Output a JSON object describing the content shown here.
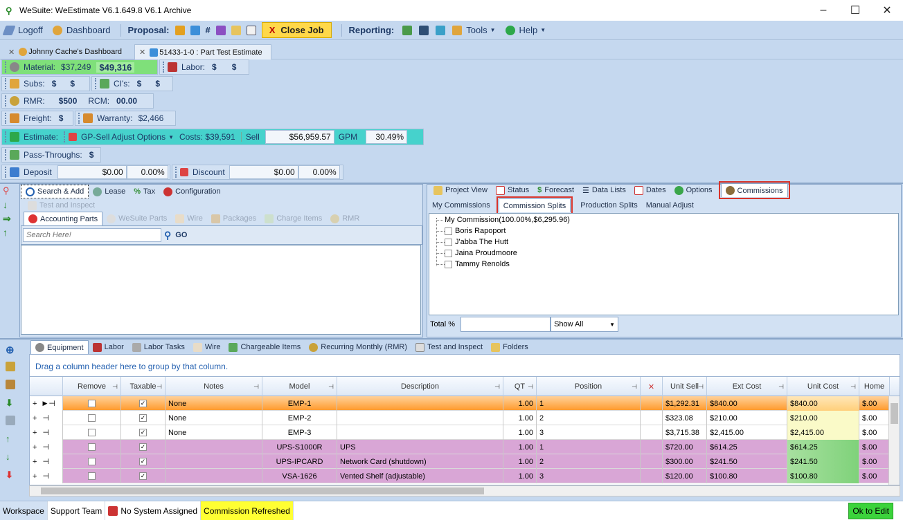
{
  "window": {
    "title": "WeSuite: WeEstimate V6.1.649.8 V6.1 Archive"
  },
  "toolbar": {
    "logoff": "Logoff",
    "dashboard": "Dashboard",
    "proposal": "Proposal:",
    "close_job": "Close Job",
    "reporting": "Reporting:",
    "tools": "Tools",
    "help": "Help"
  },
  "doc_tabs": [
    {
      "label": "Johnny Cache's Dashboard"
    },
    {
      "label": "51433-1-0 : Part Test Estimate"
    }
  ],
  "summary": {
    "material_label": "Material:",
    "material_cost": "$37,249",
    "material_sell": "$49,316",
    "labor_label": "Labor:",
    "labor_cost": "$",
    "labor_sell": "$",
    "subs_label": "Subs:",
    "subs_cost": "$",
    "subs_sell": "$",
    "cis_label": "CI's:",
    "cis_cost": "$",
    "cis_sell": "$",
    "rmr_label": "RMR:",
    "rmr_value": "$500",
    "rcm_label": "RCM:",
    "rcm_value": "00.00",
    "freight_label": "Freight:",
    "freight_value": "$",
    "warranty_label": "Warranty:",
    "warranty_value": "$2,466",
    "estimate_label": "Estimate:",
    "gp_sell_label": "GP-Sell Adjust Options",
    "costs_text": "Costs: $39,591",
    "sell_label": "Sell",
    "sell_value": "$56,959.57",
    "gpm_label": "GPM",
    "gpm_value": "30.49%",
    "pass_label": "Pass-Throughs:",
    "pass_value": "$",
    "deposit_label": "Deposit",
    "deposit_amount": "$0.00",
    "deposit_pct": "0.00%",
    "discount_label": "Discount",
    "discount_amount": "$0.00",
    "discount_pct": "0.00%"
  },
  "left_panel": {
    "tabs_row1": [
      "Search & Add",
      "Lease",
      "Tax",
      "Configuration"
    ],
    "tabs_row2": [
      "Test and Inspect"
    ],
    "tabs_row3": [
      "Accounting Parts",
      "WeSuite Parts",
      "Wire",
      "Packages",
      "Charge Items",
      "RMR"
    ],
    "search_placeholder": "Search Here!",
    "go_label": "GO"
  },
  "right_panel": {
    "tabs": [
      "Project View",
      "Status",
      "Forecast",
      "Data Lists",
      "Dates",
      "Options",
      "Commissions"
    ],
    "subtabs": [
      "My Commissions",
      "Commission Splits",
      "Production Splits",
      "Manual Adjust"
    ],
    "tree_root": "My Commission(100.00%,$6,295.96)",
    "tree_items": [
      "Boris Rapoport",
      "J'abba The Hutt",
      "Jaina Proudmoore",
      "Tammy Renolds"
    ],
    "total_label": "Total %",
    "show_all": "Show All"
  },
  "bottom": {
    "tabs": [
      "Equipment",
      "Labor",
      "Labor Tasks",
      "Wire",
      "Chargeable Items",
      "Recurring Monthly (RMR)",
      "Test and Inspect",
      "Folders"
    ],
    "group_hint": "Drag a column header here to group by that column.",
    "columns": [
      "Remove",
      "Taxable",
      "Notes",
      "Model",
      "Description",
      "QT",
      "Position",
      "Unit Sell",
      "Ext Cost",
      "Unit Cost",
      "Home"
    ],
    "rows": [
      {
        "notes": "None",
        "model": "EMP-1",
        "desc": "",
        "qt": "1.00",
        "pos": "1",
        "unit_sell": "$1,292.31",
        "ext_cost": "$840.00",
        "unit_cost": "$840.00",
        "home": "$.00",
        "remove": false,
        "taxable": true
      },
      {
        "notes": "None",
        "model": "EMP-2",
        "desc": "",
        "qt": "1.00",
        "pos": "2",
        "unit_sell": "$323.08",
        "ext_cost": "$210.00",
        "unit_cost": "$210.00",
        "home": "$.00",
        "remove": false,
        "taxable": true
      },
      {
        "notes": "None",
        "model": "EMP-3",
        "desc": "",
        "qt": "1.00",
        "pos": "3",
        "unit_sell": "$3,715.38",
        "ext_cost": "$2,415.00",
        "unit_cost": "$2,415.00",
        "home": "$.00",
        "remove": false,
        "taxable": true
      },
      {
        "notes": "",
        "model": "UPS-S1000R",
        "desc": "UPS",
        "qt": "1.00",
        "pos": "1",
        "unit_sell": "$720.00",
        "ext_cost": "$614.25",
        "unit_cost": "$614.25",
        "home": "$.00",
        "remove": false,
        "taxable": true
      },
      {
        "notes": "",
        "model": "UPS-IPCARD",
        "desc": "Network Card (shutdown)",
        "qt": "1.00",
        "pos": "2",
        "unit_sell": "$300.00",
        "ext_cost": "$241.50",
        "unit_cost": "$241.50",
        "home": "$.00",
        "remove": false,
        "taxable": true
      },
      {
        "notes": "",
        "model": "VSA-1626",
        "desc": "Vented Shelf (adjustable)",
        "qt": "1.00",
        "pos": "3",
        "unit_sell": "$120.00",
        "ext_cost": "$100.80",
        "unit_cost": "$100.80",
        "home": "$.00",
        "remove": false,
        "taxable": true
      }
    ]
  },
  "statusbar": {
    "workspace": "Workspace",
    "team": "Support Team",
    "system": "No System Assigned",
    "message": "Commission Refreshed",
    "ok": "Ok to Edit"
  },
  "colors": {
    "accent": "#c5d8ef",
    "highlight_row": "#ffa640",
    "purple_row": "#d9a6d6",
    "material_green": "#7fe07a",
    "estimate_teal": "#46d2cc"
  }
}
